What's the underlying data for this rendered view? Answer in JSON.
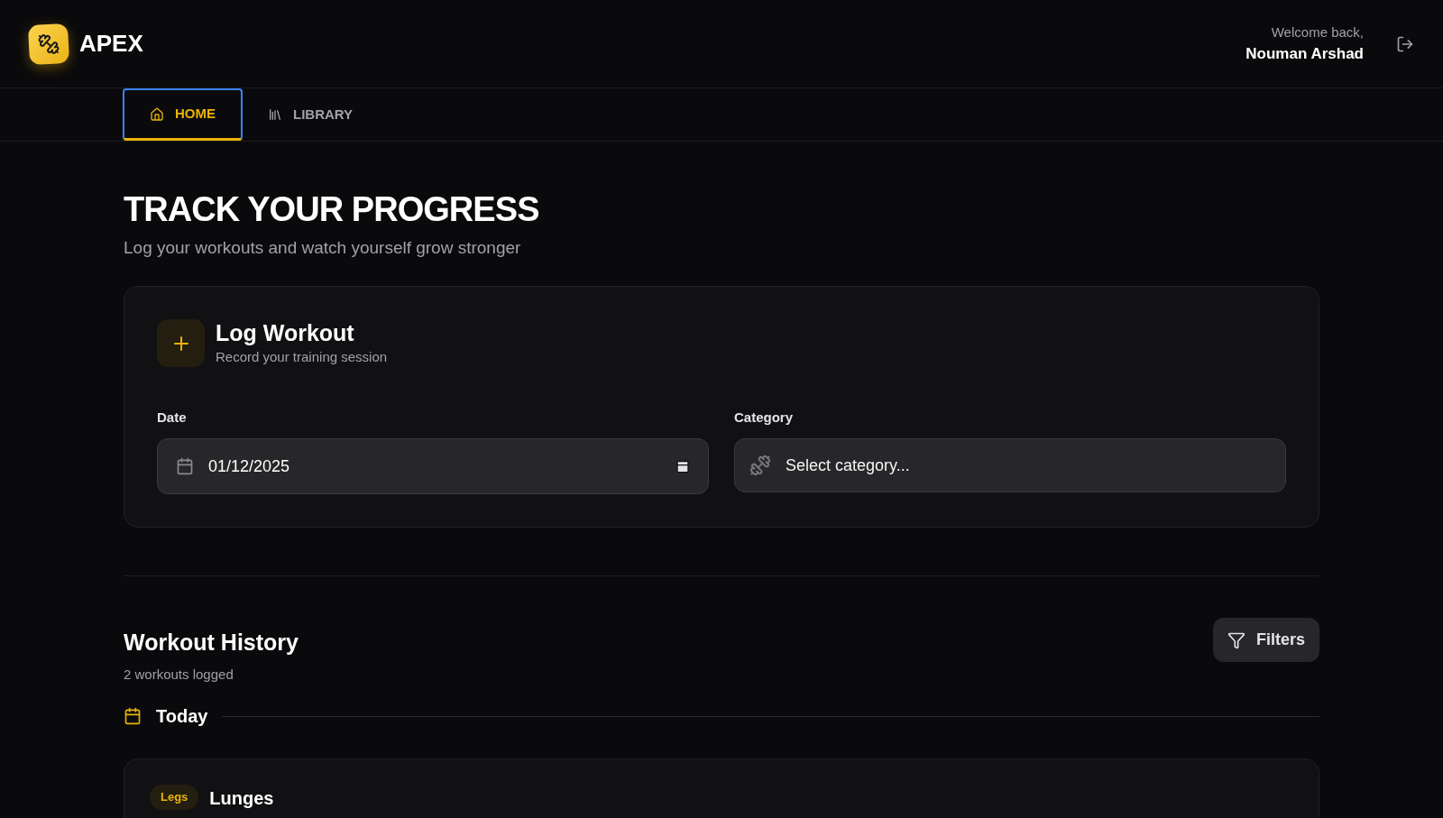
{
  "header": {
    "brand": "APEX",
    "greeting": "Welcome back,",
    "user_name": "Nouman Arshad"
  },
  "tabs": [
    {
      "label": "HOME",
      "kind": "home",
      "selected": true
    },
    {
      "label": "LIBRARY",
      "kind": "library",
      "selected": false
    }
  ],
  "hero": {
    "title": "TRACK YOUR PROGRESS",
    "subtitle": "Log your workouts and watch yourself grow stronger"
  },
  "log_workout": {
    "title": "Log Workout",
    "subtitle": "Record your training session",
    "date_label": "Date",
    "date_value": "01/12/2025",
    "category_label": "Category",
    "category_placeholder": "Select category..."
  },
  "history": {
    "title": "Workout History",
    "count": "2 workouts logged",
    "filters_button": "Filters",
    "groups": [
      {
        "label": "Today",
        "workouts": [
          {
            "category": "Legs",
            "color": "#eab308",
            "name": "Lunges"
          }
        ]
      }
    ]
  }
}
